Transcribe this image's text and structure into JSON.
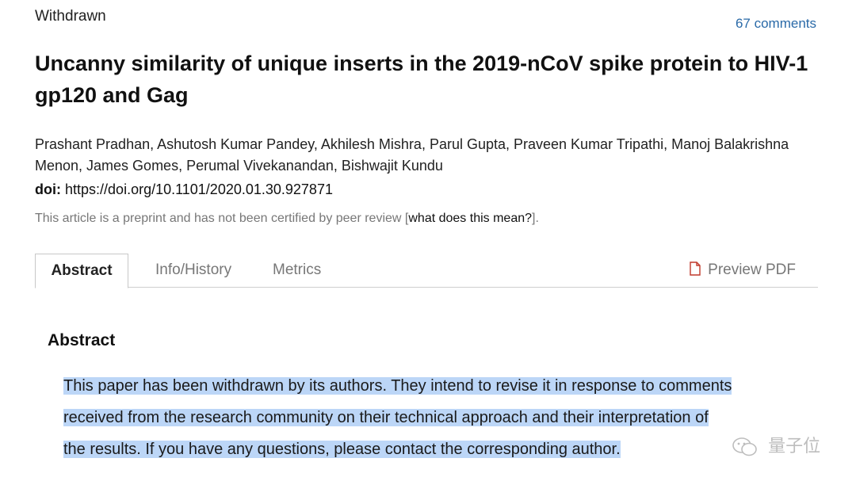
{
  "article": {
    "status": "Withdrawn",
    "comments": "67 comments",
    "title": "Uncanny similarity of unique inserts in the 2019-nCoV spike protein to HIV-1 gp120 and Gag",
    "authors": "Prashant Pradhan, Ashutosh Kumar Pandey, Akhilesh Mishra, Parul Gupta, Praveen Kumar Tripathi, Manoj Balakrishna Menon, James Gomes, Perumal Vivekanandan, Bishwajit Kundu",
    "doi_label": "doi:",
    "doi_value": "https://doi.org/10.1101/2020.01.30.927871",
    "notice_text": "This article is a preprint and has not been certified by peer review [",
    "notice_link": "what does this mean?",
    "notice_end": "]."
  },
  "tabs": {
    "abstract": "Abstract",
    "info": "Info/History",
    "metrics": "Metrics",
    "preview_pdf": "Preview PDF"
  },
  "abstract": {
    "heading": "Abstract",
    "line1": "This paper has been withdrawn by its authors. They intend to revise it in response to comments",
    "line2": "received from the research community on their technical approach and their interpretation of",
    "line3": "the results. If you have any questions, please contact the corresponding author."
  },
  "watermark": "量子位",
  "colors": {
    "link": "#2a6aa8",
    "highlight": "#bcd6f7",
    "muted": "#777777"
  }
}
